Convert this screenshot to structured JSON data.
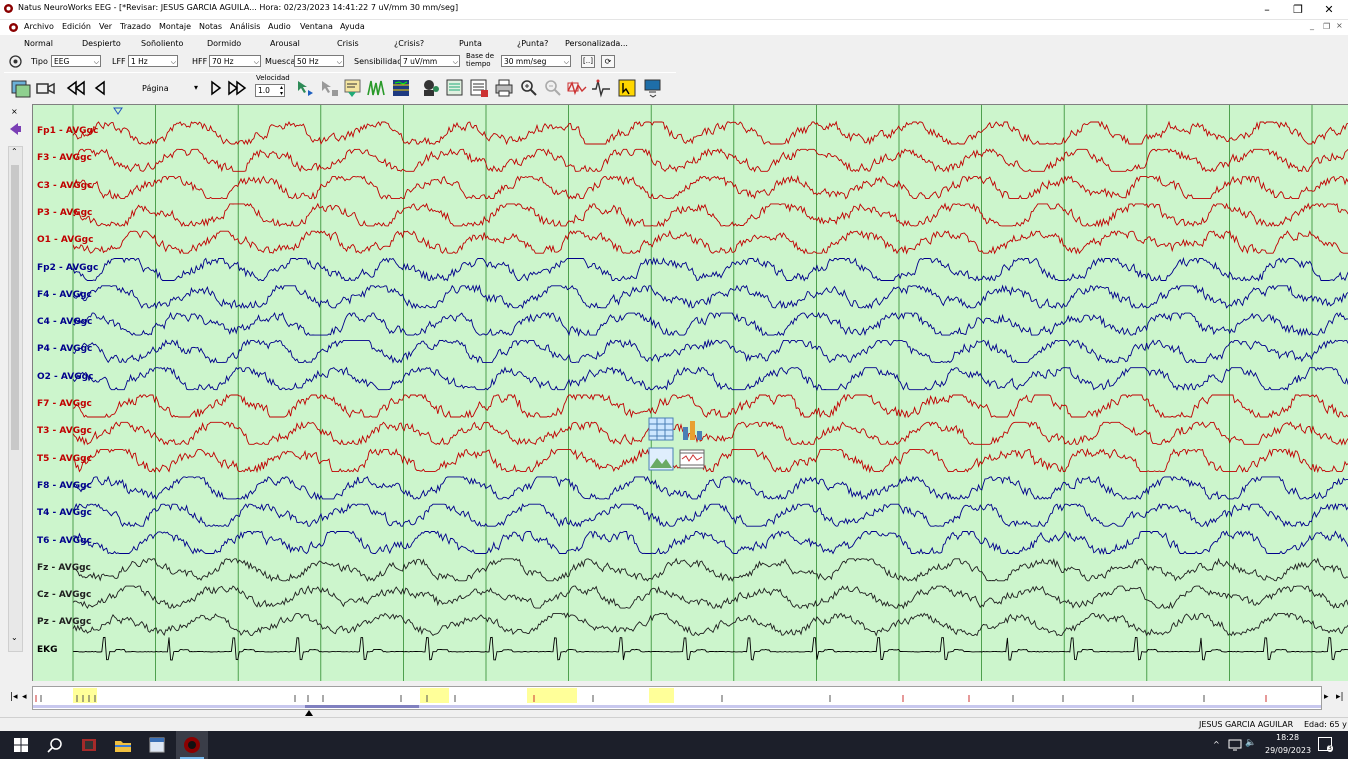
{
  "window": {
    "title": "Natus NeuroWorks EEG - [*Revisar:   JESUS  GARCIA AGUILA...   Hora: 02/23/2023 14:41:22   7 uV/mm   30 mm/seg]",
    "minimize": "–",
    "restore": "❐",
    "close": "✕",
    "child_minimize": "_",
    "child_restore": "❐",
    "child_close": "×"
  },
  "menu": [
    "Archivo",
    "Edición",
    "Ver",
    "Trazado",
    "Montaje",
    "Notas",
    "Análisis",
    "Audio",
    "Ventana",
    "Ayuda"
  ],
  "presets": [
    "Normal",
    "Despierto",
    "Soñoliento",
    "Dormido",
    "Arousal",
    "Crisis",
    "¿Crisis?",
    "Punta",
    "¿Punta?",
    "Personalizada..."
  ],
  "controls": {
    "tipo_label": "Tipo",
    "tipo_value": "EEG",
    "lff_label": "LFF",
    "lff_value": "1 Hz",
    "hff_label": "HFF",
    "hff_value": "70 Hz",
    "muesca_label": "Muesca",
    "muesca_value": "50 Hz",
    "sensibilidad_label": "Sensibilidad",
    "sensibilidad_value": "7 uV/mm",
    "base_label_1": "Base de",
    "base_label_2": "tiempo",
    "base_value": "30 mm/seg",
    "bracket_btn": "[..]"
  },
  "navigation": {
    "pagina_label": "Página",
    "velocidad_label": "Velocidad",
    "velocidad_value": "1.0"
  },
  "channels": [
    {
      "label": "Fp1 - AVGgc",
      "color": "#c00000"
    },
    {
      "label": "F3 - AVGgc",
      "color": "#c00000"
    },
    {
      "label": "C3 - AVGgc",
      "color": "#c00000"
    },
    {
      "label": "P3 - AVGgc",
      "color": "#c00000"
    },
    {
      "label": "O1 - AVGgc",
      "color": "#c00000"
    },
    {
      "label": "Fp2 - AVGgc",
      "color": "#00008b"
    },
    {
      "label": "F4 - AVGgc",
      "color": "#00008b"
    },
    {
      "label": "C4 - AVGgc",
      "color": "#00008b"
    },
    {
      "label": "P4 - AVGgc",
      "color": "#00008b"
    },
    {
      "label": "O2 - AVGgc",
      "color": "#00008b"
    },
    {
      "label": "F7 - AVGgc",
      "color": "#c00000"
    },
    {
      "label": "T3 - AVGgc",
      "color": "#c00000"
    },
    {
      "label": "T5 - AVGgc",
      "color": "#c00000"
    },
    {
      "label": "F8 - AVGgc",
      "color": "#00008b"
    },
    {
      "label": "T4 - AVGgc",
      "color": "#00008b"
    },
    {
      "label": "T6 - AVGgc",
      "color": "#00008b"
    },
    {
      "label": "Fz - AVGgc",
      "color": "#202020"
    },
    {
      "label": "Cz - AVGgc",
      "color": "#202020"
    },
    {
      "label": "Pz - AVGgc",
      "color": "#202020"
    },
    {
      "label": "EKG",
      "color": "#000000"
    }
  ],
  "colors": {
    "eeg_background": "#ccf5cc",
    "grid_line": "#2e8b2e",
    "overview_highlight": "#ffff99"
  },
  "status": {
    "patient": "JESUS  GARCIA AGUILAR",
    "age": "Edad: 65 y"
  },
  "taskbar": {
    "time": "18:28",
    "date": "29/09/2023",
    "notifications": "3"
  }
}
